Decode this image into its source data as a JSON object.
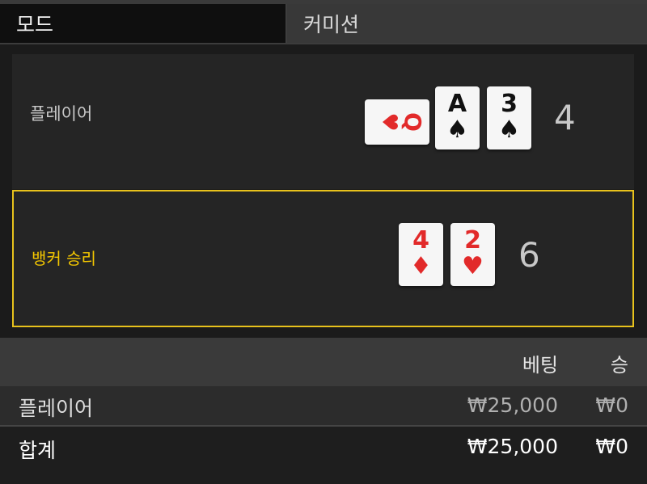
{
  "mode": {
    "label": "모드",
    "value": "커미션"
  },
  "hands": {
    "player": {
      "label": "플레이어",
      "score": "4",
      "cards": [
        {
          "rank": "Q",
          "suit": "♥",
          "suit_name": "heart-icon",
          "color": "#e22a2a",
          "rotated": true
        },
        {
          "rank": "A",
          "suit": "♠",
          "suit_name": "spade-icon",
          "color": "#111111",
          "rotated": false
        },
        {
          "rank": "3",
          "suit": "♠",
          "suit_name": "spade-icon",
          "color": "#111111",
          "rotated": false
        }
      ]
    },
    "banker": {
      "label": "뱅커 승리",
      "score": "6",
      "highlight_color": "#e8c21c",
      "cards": [
        {
          "rank": "4",
          "suit": "♦",
          "suit_name": "diamond-icon",
          "color": "#e22a2a",
          "rotated": false
        },
        {
          "rank": "2",
          "suit": "♥",
          "suit_name": "heart-icon",
          "color": "#e22a2a",
          "rotated": false
        }
      ]
    }
  },
  "summary": {
    "header": {
      "bet": "베팅",
      "win": "승"
    },
    "rows": [
      {
        "name": "플레이어",
        "bet": "₩25,000",
        "win": "₩0"
      }
    ],
    "total": {
      "name": "합계",
      "bet": "₩25,000",
      "win": "₩0"
    }
  }
}
